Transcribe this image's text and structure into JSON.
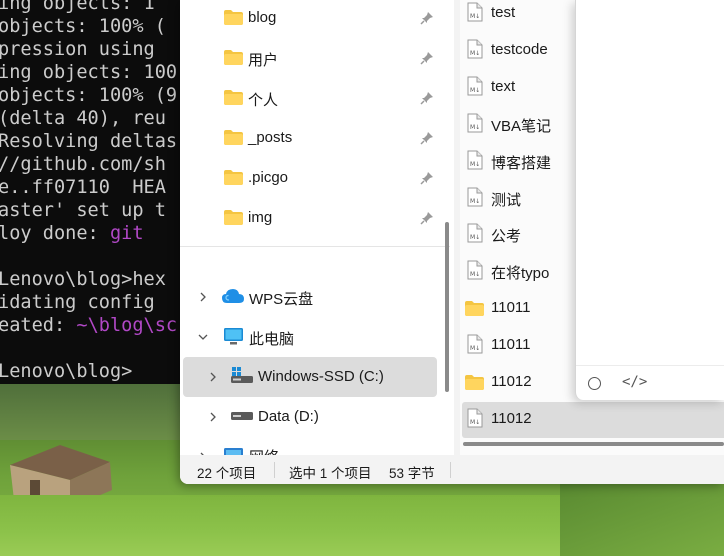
{
  "terminal": {
    "lines": [
      {
        "a": "ing objects: 1",
        "b": ""
      },
      {
        "a": "objects: 100% (",
        "b": ""
      },
      {
        "a": "pression using",
        "b": ""
      },
      {
        "a": "ing objects: 100",
        "b": ""
      },
      {
        "a": "objects: 100% (9",
        "b": ""
      },
      {
        "a": "(delta 40), reu",
        "b": ""
      },
      {
        "a": "Resolving deltas",
        "b": ""
      },
      {
        "a": "//github.com/sh",
        "b": ""
      },
      {
        "a": "e..ff07110  HEA",
        "b": ""
      },
      {
        "a": "aster' set up t",
        "b": ""
      },
      {
        "a": "loy done: ",
        "b": "git"
      },
      {
        "a": "",
        "b": ""
      },
      {
        "a": "Lenovo\\blog>hex",
        "b": ""
      },
      {
        "a": "idating config",
        "b": ""
      },
      {
        "a": "eated: ",
        "b": "~\\blog\\sc"
      },
      {
        "a": "",
        "b": ""
      },
      {
        "a": "Lenovo\\blog>",
        "b": ""
      }
    ]
  },
  "nav": {
    "quick_access": [
      {
        "label": "blog"
      },
      {
        "label": "用户"
      },
      {
        "label": "个人"
      },
      {
        "label": "_posts"
      },
      {
        "label": ".picgo"
      },
      {
        "label": "img"
      }
    ],
    "wps": "WPS云盘",
    "this_pc": "此电脑",
    "drive_c": "Windows-SSD (C:)",
    "drive_d": "Data (D:)",
    "network": "网络"
  },
  "files": [
    {
      "name": "test",
      "kind": "md"
    },
    {
      "name": "testcode",
      "kind": "md"
    },
    {
      "name": "text",
      "kind": "md"
    },
    {
      "name": "VBA笔记",
      "kind": "md"
    },
    {
      "name": "博客搭建",
      "kind": "md"
    },
    {
      "name": "测试",
      "kind": "md"
    },
    {
      "name": "公考",
      "kind": "md"
    },
    {
      "name": "在将typo",
      "kind": "md"
    },
    {
      "name": "11011",
      "kind": "folder"
    },
    {
      "name": "11011",
      "kind": "md"
    },
    {
      "name": "11012",
      "kind": "folder"
    },
    {
      "name": "11012",
      "kind": "md"
    }
  ],
  "status": {
    "count": "22 个项目",
    "selected": "选中 1 个项目",
    "size": "53 字节"
  },
  "editor": {
    "code_icon": "</>"
  },
  "colors": {
    "folder": "#f4c542",
    "selection": "#dcdcdc",
    "terminal_accent": "#b148c6"
  }
}
